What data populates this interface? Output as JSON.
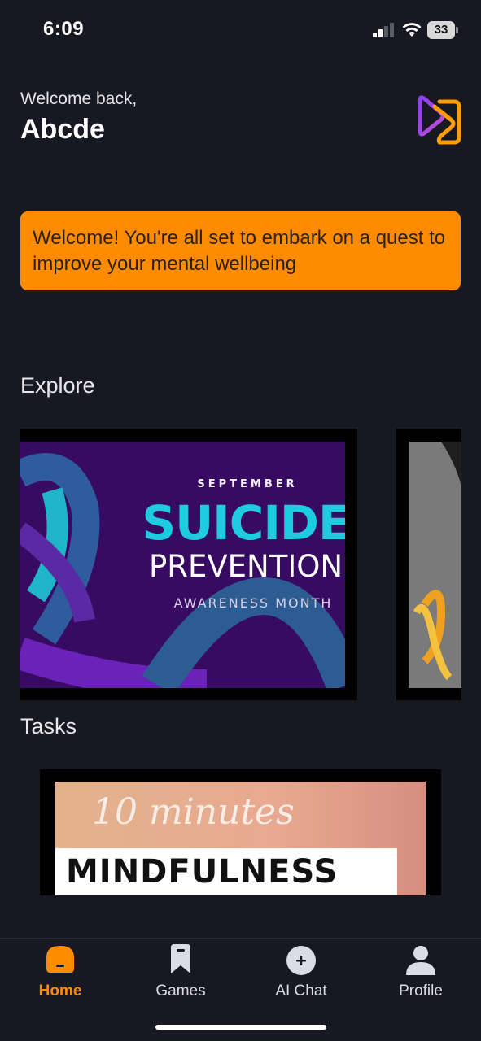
{
  "status_bar": {
    "time": "6:09",
    "battery": "33"
  },
  "header": {
    "greeting": "Welcome back,",
    "username": "Abcde",
    "logo_icon": "app-logo-icon"
  },
  "banner": {
    "text": "Welcome! You're all set to embark on a quest to improve your mental wellbeing",
    "color": "#ff8c00"
  },
  "explore": {
    "title": "Explore",
    "cards": [
      {
        "line1": "SEPTEMBER",
        "line2": "SUICIDE",
        "line3": "PREVENTION",
        "line4": "AWARENESS MONTH"
      },
      {
        "image": "awareness-ribbon-photo"
      }
    ]
  },
  "tasks": {
    "title": "Tasks",
    "cards": [
      {
        "line1": "10 minutes",
        "line2": "MINDFULNESS"
      }
    ]
  },
  "tab_bar": {
    "tabs": [
      {
        "label": "Home",
        "icon": "home-icon",
        "active": true
      },
      {
        "label": "Games",
        "icon": "bookmark-icon",
        "active": false
      },
      {
        "label": "AI Chat",
        "icon": "plus-circle-icon",
        "active": false
      },
      {
        "label": "Profile",
        "icon": "person-icon",
        "active": false
      }
    ],
    "active_color": "#ff8c00"
  }
}
